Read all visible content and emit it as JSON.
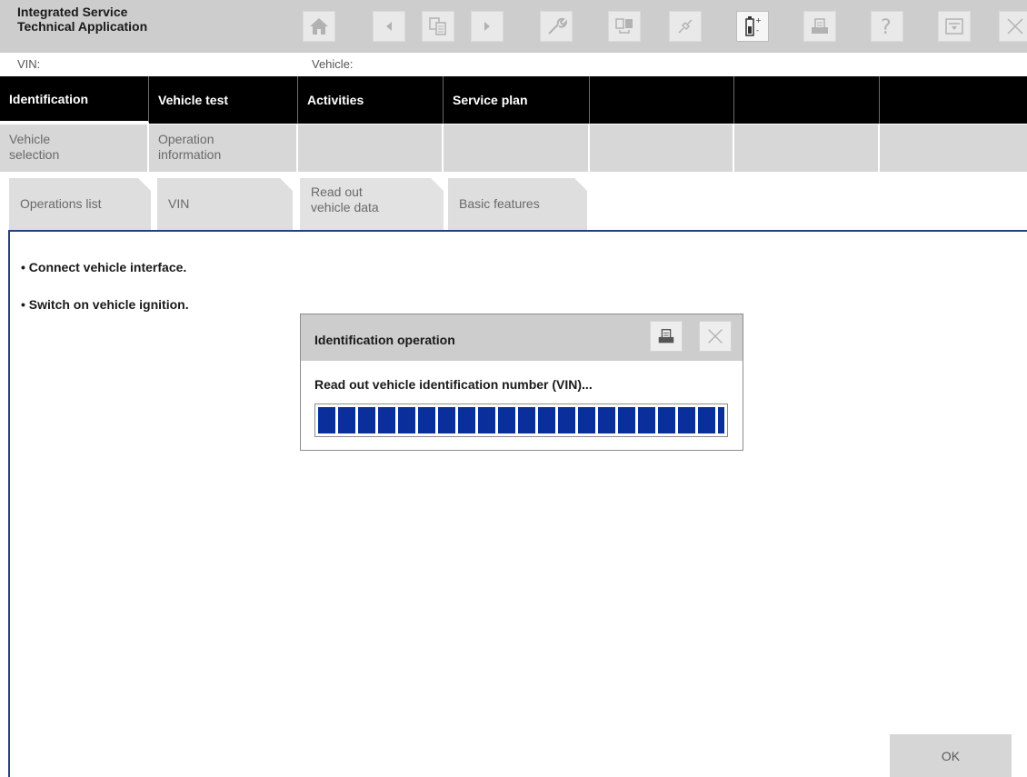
{
  "header": {
    "title": "Integrated Service\nTechnical Application",
    "toolbar": [
      {
        "icon": "home-icon"
      },
      {
        "icon": "back-arrow-icon"
      },
      {
        "icon": "documents-icon"
      },
      {
        "icon": "forward-arrow-icon"
      },
      {
        "icon": "wrench-icon"
      },
      {
        "icon": "transfer-icon"
      },
      {
        "icon": "connection-icon"
      },
      {
        "icon": "battery-icon"
      },
      {
        "icon": "printer-icon"
      },
      {
        "icon": "help-icon"
      },
      {
        "icon": "window-icon"
      },
      {
        "icon": "close-icon"
      }
    ]
  },
  "info": {
    "vin_label": "VIN:",
    "vehicle_label": "Vehicle:"
  },
  "nav": {
    "items": [
      "Identification",
      "Vehicle test",
      "Activities",
      "Service plan",
      "",
      "",
      ""
    ]
  },
  "subnav": {
    "items": [
      "Vehicle\nselection",
      "Operation\ninformation",
      "",
      "",
      "",
      "",
      ""
    ]
  },
  "tabs": {
    "items": [
      "Operations list",
      "VIN",
      "Read out\nvehicle data",
      "Basic features"
    ],
    "active": "Read out\nvehicle data"
  },
  "content": {
    "instructions": [
      "• Connect vehicle interface.",
      "• Switch on vehicle ignition."
    ]
  },
  "dialog": {
    "title": "Identification operation",
    "message": "Read out vehicle identification number (VIN)...",
    "progress": 1.0,
    "progress_color": "#0a2f9c"
  },
  "ok_label": "OK",
  "colors": {
    "header_bg": "#cdcdcd",
    "nav_bg": "#000000",
    "accent": "#23437a"
  }
}
